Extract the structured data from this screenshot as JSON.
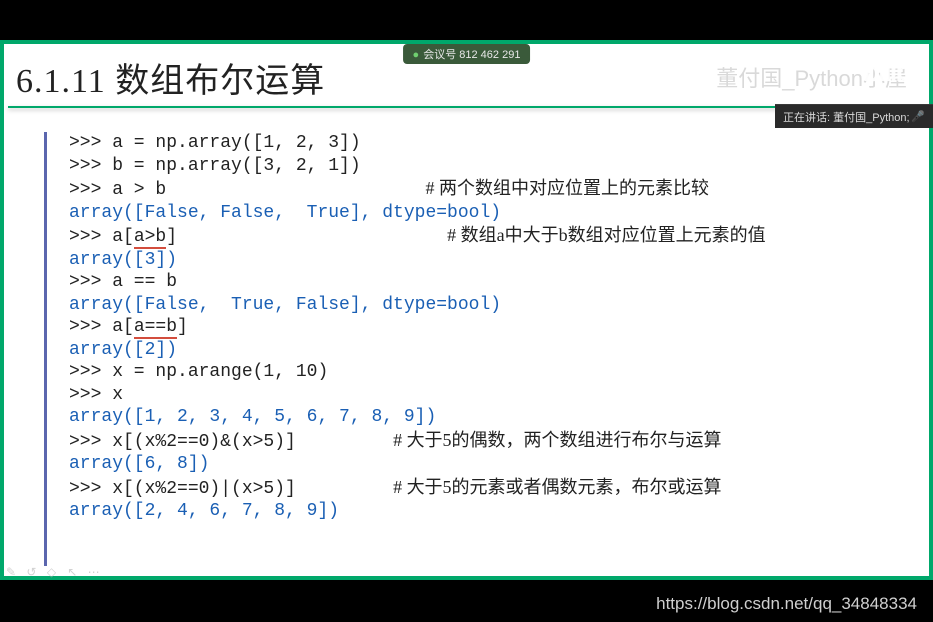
{
  "meeting": {
    "label": "会议号 812 462 291"
  },
  "header": {
    "title": "6.1.11  数组布尔运算",
    "credit": "董付国_Python小屋"
  },
  "status": {
    "text": "正在讲话: 董付国_Python;"
  },
  "code": {
    "l1": ">>> a = np.array([1, 2, 3])",
    "l2": ">>> b = np.array([3, 2, 1])",
    "l3a": ">>> a > b",
    "l3c": "# 两个数组中对应位置上的元素比较",
    "l4": "array([False, False,  True], dtype=bool)",
    "l5a": ">>> a[",
    "l5b": "a>b",
    "l5c": "]",
    "l5d": "# 数组a中大于b数组对应位置上元素的值",
    "l6": "array([3])",
    "l7": ">>> a == b",
    "l8": "array([False,  True, False], dtype=bool)",
    "l9a": ">>> a[",
    "l9b": "a==b",
    "l9c": "]",
    "l10": "array([2])",
    "l11": ">>> x = np.arange(1, 10)",
    "l12": ">>> x",
    "l13": "array([1, 2, 3, 4, 5, 6, 7, 8, 9])",
    "l14a": ">>> x[(x%2==0)&(x>5)]",
    "l14c": "# 大于5的偶数，两个数组进行布尔与运算",
    "l15": "array([6, 8])",
    "l16a": ">>> x[(x%2==0)|(x>5)]",
    "l16c": "# 大于5的元素或者偶数元素，布尔或运算",
    "l17": "array([2, 4, 6, 7, 8, 9])"
  },
  "watermark": "https://blog.csdn.net/qq_34848334",
  "logo": "bilibili"
}
